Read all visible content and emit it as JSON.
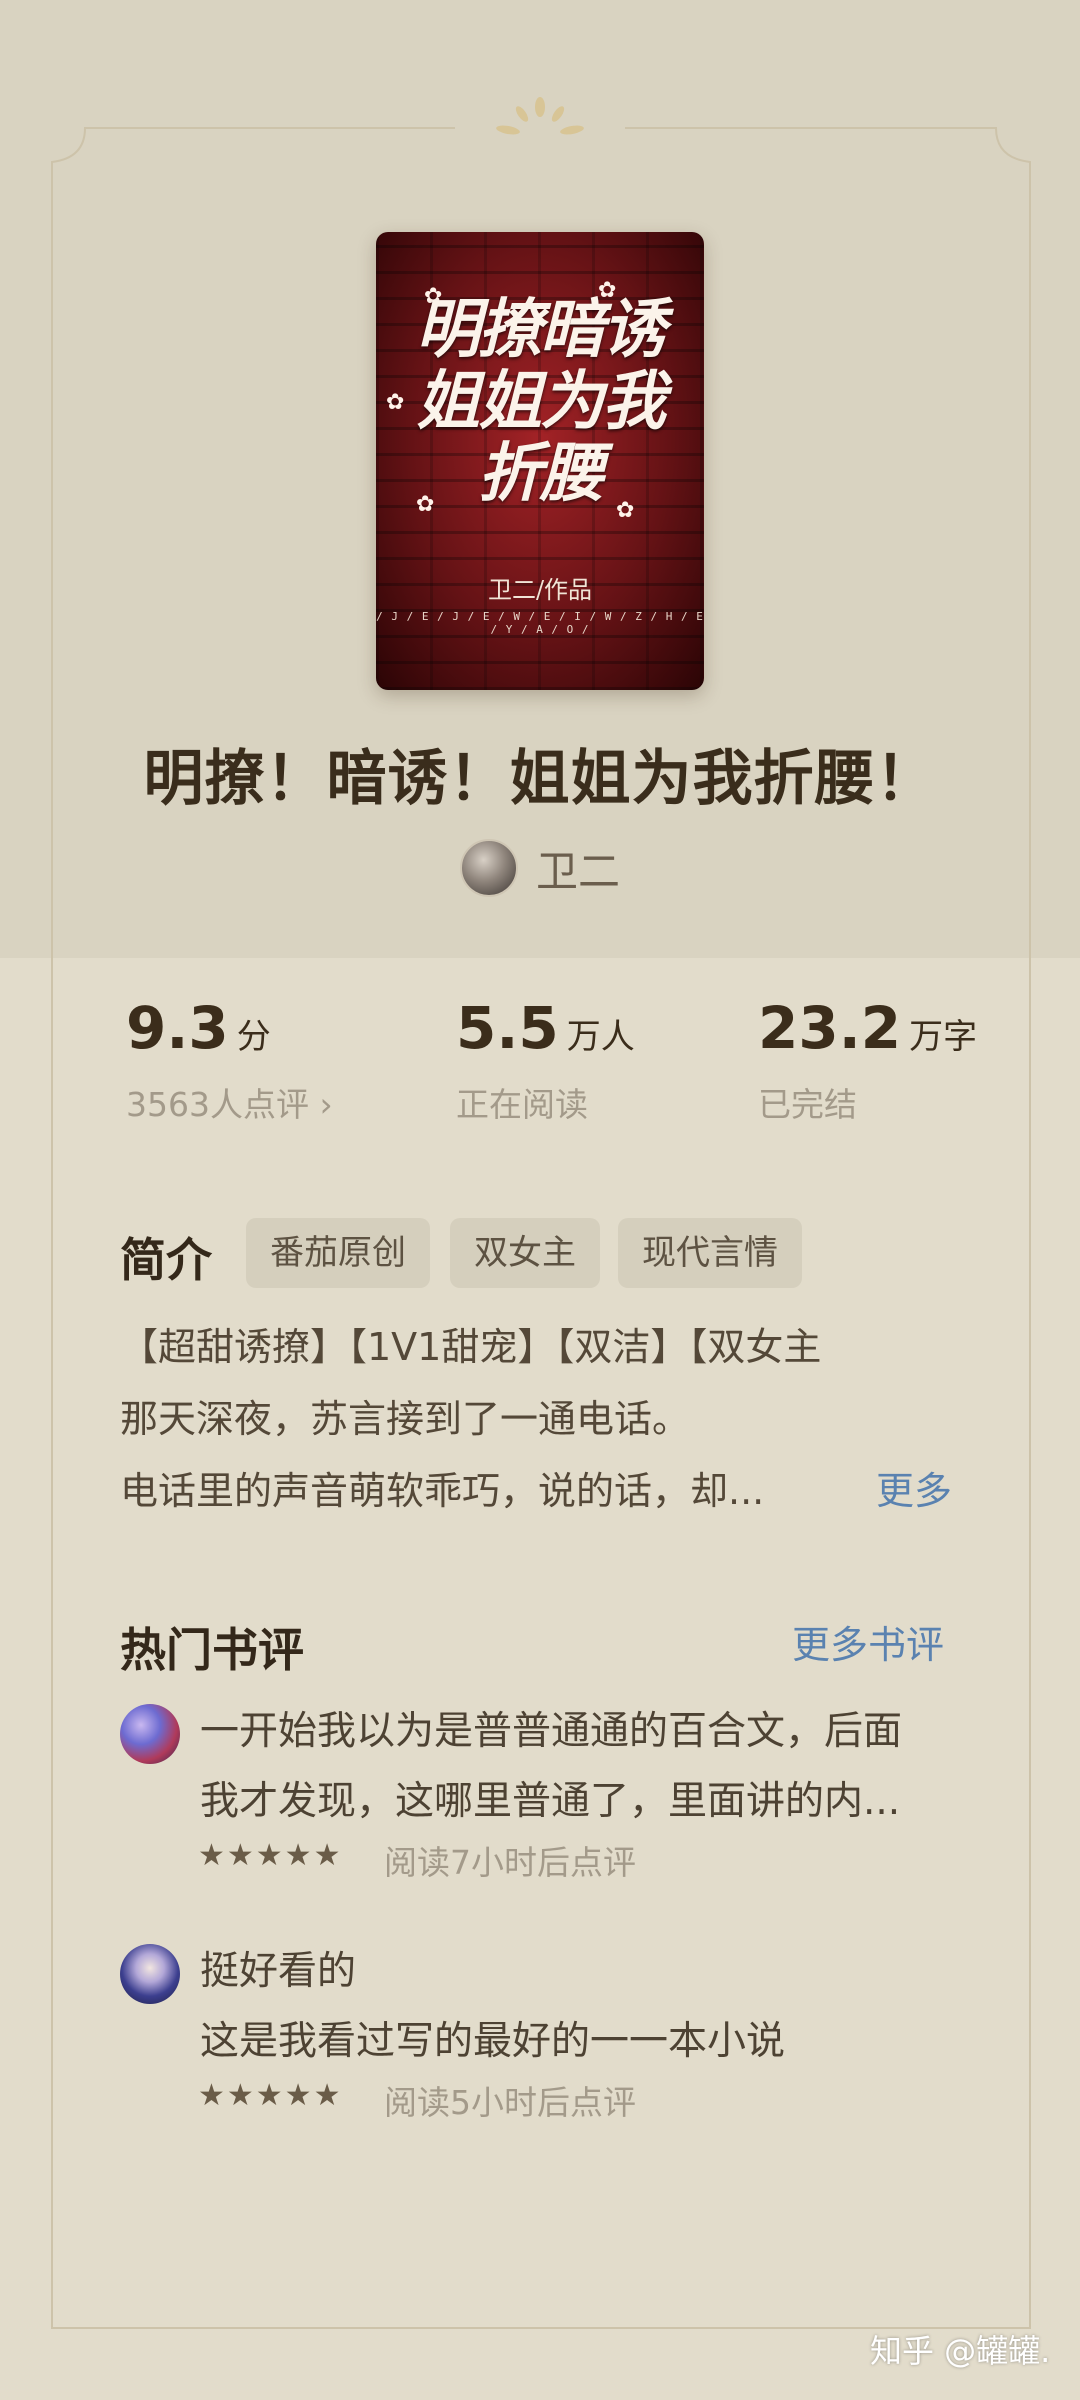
{
  "book": {
    "cover_title_lines": [
      "明撩暗诱",
      "姐姐为我",
      "折腰"
    ],
    "cover_author": "卫二/作品",
    "cover_letters": "/ J / E / J / E / W / E / I / W / Z / H / E / Y / A / O /",
    "title": "明撩！暗诱！姐姐为我折腰！",
    "author": "卫二"
  },
  "stats": {
    "rating": {
      "value": "9.3",
      "unit": "分",
      "sub": "3563人点评 ›"
    },
    "readers": {
      "value": "5.5",
      "unit": "万人",
      "sub": "正在阅读"
    },
    "words": {
      "value": "23.2",
      "unit": "万字",
      "sub": "已完结"
    }
  },
  "intro": {
    "title": "简介",
    "tags": [
      "番茄原创",
      "双女主",
      "现代言情"
    ],
    "lines": [
      "【超甜诱撩】【1V1甜宠】【双洁】【双女主",
      "那天深夜，苏言接到了一通电话。",
      "电话里的声音萌软乖巧，说的话，却..."
    ],
    "more": "更多"
  },
  "reviews": {
    "title": "热门书评",
    "more": "更多书评",
    "items": [
      {
        "lines": [
          "一开始我以为是普普通通的百合文，后面",
          "我才发现，这哪里普通了，里面讲的内..."
        ],
        "stars": "★★★★★",
        "meta": "阅读7小时后点评"
      },
      {
        "lines": [
          "挺好看的",
          "这是我看过写的最好的一一本小说"
        ],
        "stars": "★★★★★",
        "meta": "阅读5小时后点评"
      }
    ]
  },
  "watermark": "知乎 @罐罐.",
  "colors": {
    "top_bg": "#d9d3c1",
    "bottom_bg": "#e2dccb",
    "accent_link": "#5a82b0",
    "frame_line": "#c9bfa6"
  }
}
